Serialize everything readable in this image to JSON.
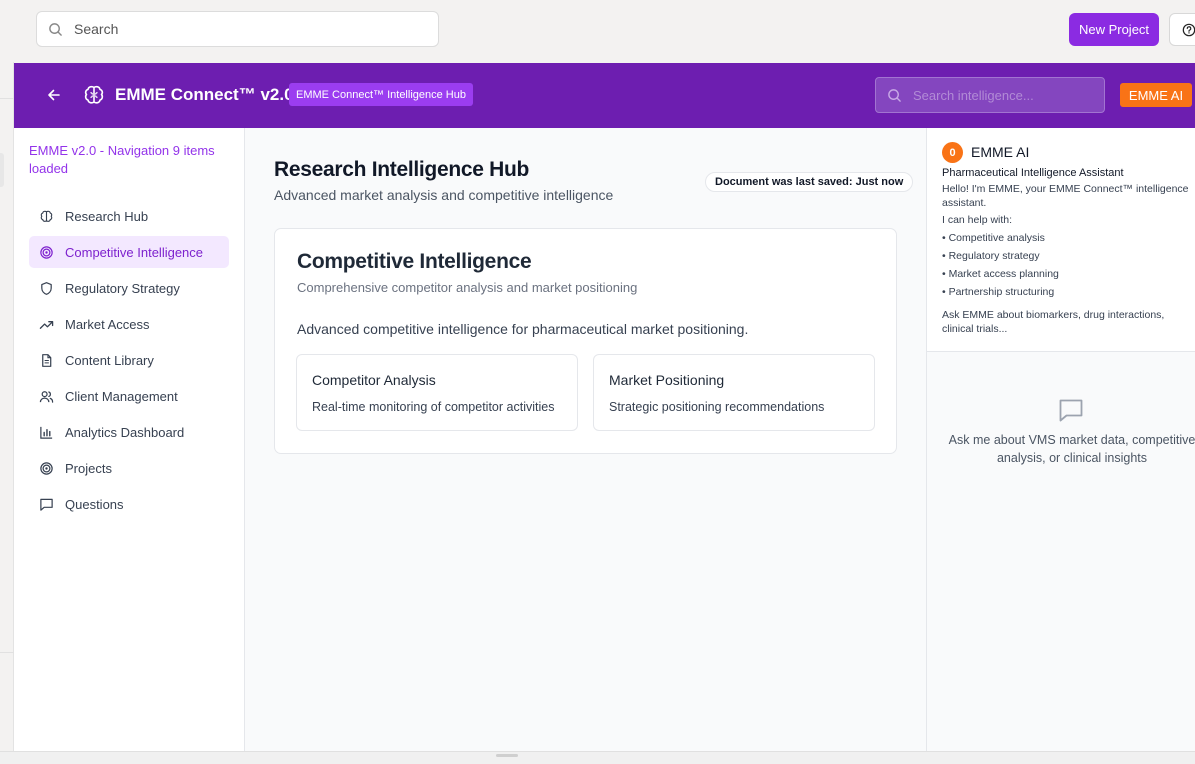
{
  "outer": {
    "search_placeholder": "Search",
    "new_project_label": "New Project",
    "help_icon": "help-circle-icon"
  },
  "header": {
    "title": "EMME Connect™ v2.0",
    "badge": "EMME Connect™ Intelligence Hub",
    "search_placeholder": "Search intelligence...",
    "ai_button": "EMME AI",
    "brand_color": "#6d1eb0",
    "accent_color": "#f97316"
  },
  "sidebar": {
    "status": "EMME v2.0 - Navigation 9 items loaded",
    "items": [
      {
        "label": "Research Hub",
        "icon": "brain-icon",
        "active": false
      },
      {
        "label": "Competitive Intelligence",
        "icon": "target-icon",
        "active": true
      },
      {
        "label": "Regulatory Strategy",
        "icon": "shield-icon",
        "active": false
      },
      {
        "label": "Market Access",
        "icon": "trending-up-icon",
        "active": false
      },
      {
        "label": "Content Library",
        "icon": "document-icon",
        "active": false
      },
      {
        "label": "Client Management",
        "icon": "users-icon",
        "active": false
      },
      {
        "label": "Analytics Dashboard",
        "icon": "bar-chart-icon",
        "active": false
      },
      {
        "label": "Projects",
        "icon": "target-icon",
        "active": false
      },
      {
        "label": "Questions",
        "icon": "message-square-icon",
        "active": false
      }
    ]
  },
  "main": {
    "title": "Research Intelligence Hub",
    "subtitle": "Advanced market analysis and competitive intelligence",
    "save_status": "Document was last saved: Just now",
    "card": {
      "title": "Competitive Intelligence",
      "subtitle": "Comprehensive competitor analysis and market positioning",
      "description": "Advanced competitive intelligence for pharmaceutical market positioning.",
      "subcards": [
        {
          "title": "Competitor Analysis",
          "description": "Real-time monitoring of competitor activities"
        },
        {
          "title": "Market Positioning",
          "description": "Strategic positioning recommendations"
        }
      ]
    }
  },
  "assistant": {
    "badge": "0",
    "name": "EMME AI",
    "role": "Pharmaceutical Intelligence Assistant",
    "greeting": "Hello! I'm EMME, your EMME Connect™ intelligence assistant.",
    "can_help": "I can help with:",
    "capabilities": [
      "• Competitive analysis",
      "• Regulatory strategy",
      "• Market access planning",
      "• Partnership structuring"
    ],
    "ask_prompt": "Ask EMME about biomarkers, drug interactions, clinical trials...",
    "empty_icon": "chat-bubble-icon",
    "empty_text": "Ask me about VMS market data, competitive analysis, or clinical insights"
  }
}
